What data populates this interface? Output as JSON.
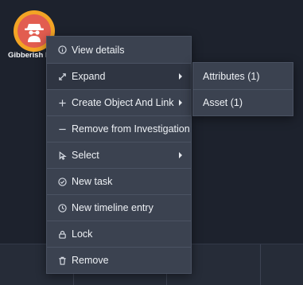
{
  "node": {
    "label": "Gibberish P",
    "icon": "spy-avatar-icon",
    "ring_color": "#f3a425",
    "fill_color": "#e25d50"
  },
  "context_menu": {
    "items": [
      {
        "label": "View details",
        "icon": "info-icon",
        "has_submenu": false
      },
      {
        "label": "Expand",
        "icon": "expand-arrows-icon",
        "has_submenu": true
      },
      {
        "label": "Create Object And Link",
        "icon": "plus-icon",
        "has_submenu": true
      },
      {
        "label": "Remove from Investigation",
        "icon": "minus-icon",
        "has_submenu": false
      },
      {
        "label": "Select",
        "icon": "cursor-icon",
        "has_submenu": true
      },
      {
        "label": "New task",
        "icon": "check-circle-icon",
        "has_submenu": false
      },
      {
        "label": "New timeline entry",
        "icon": "clock-icon",
        "has_submenu": false
      },
      {
        "label": "Lock",
        "icon": "lock-icon",
        "has_submenu": false
      },
      {
        "label": "Remove",
        "icon": "trash-icon",
        "has_submenu": false
      }
    ]
  },
  "expand_submenu": {
    "items": [
      {
        "label": "Attributes (1)"
      },
      {
        "label": "Asset (1)"
      }
    ]
  }
}
